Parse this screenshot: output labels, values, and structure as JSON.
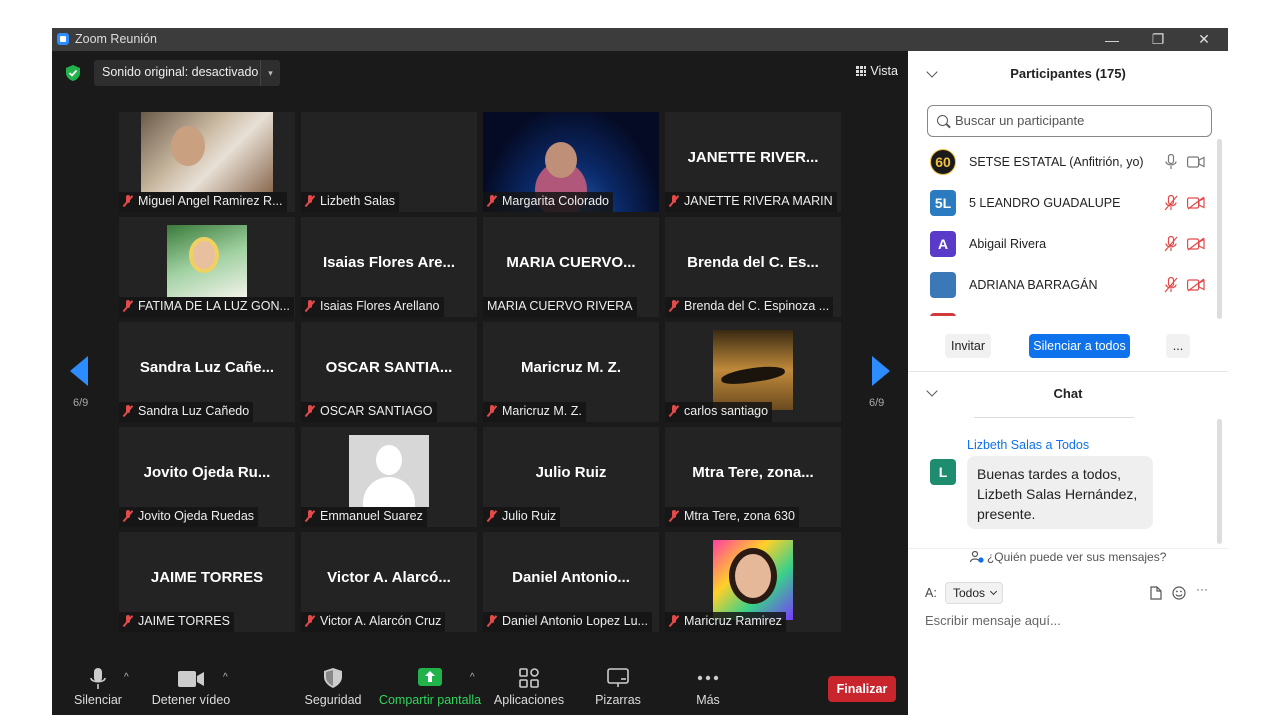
{
  "window": {
    "title": "Zoom Reunión",
    "minimize": "—",
    "restore": "❐",
    "close": "✕"
  },
  "meeting": {
    "sound_label": "Sonido original: desactivado",
    "sound_caret": "▾",
    "view_label": "Vista",
    "page_indicator_left": "6/9",
    "page_indicator_right": "6/9",
    "tiles": [
      {
        "caption": "Miguel Angel Ramirez R...",
        "big": "",
        "photo": "p1"
      },
      {
        "caption": "Lizbeth Salas",
        "big": "",
        "photo": ""
      },
      {
        "caption": "Margarita Colorado",
        "big": "",
        "photo": "p3"
      },
      {
        "caption": "JANETTE RIVERA MARIN",
        "big": "JANETTE RIVER...",
        "photo": ""
      },
      {
        "caption": "FATIMA DE LA LUZ GON...",
        "big": "",
        "photo": "p5"
      },
      {
        "caption": "Isaias Flores Arellano",
        "big": "Isaias Flores Are...",
        "photo": ""
      },
      {
        "caption": "MARIA CUERVO RIVERA",
        "big": "MARIA CUERVO...",
        "photo": "",
        "nomic": true
      },
      {
        "caption": "Brenda del C. Espinoza ...",
        "big": "Brenda del C. Es...",
        "photo": ""
      },
      {
        "caption": "Sandra Luz Cañedo",
        "big": "Sandra Luz Cañe...",
        "photo": ""
      },
      {
        "caption": "OSCAR SANTIAGO",
        "big": "OSCAR SANTIA...",
        "photo": ""
      },
      {
        "caption": "Maricruz M. Z.",
        "big": "Maricruz M. Z.",
        "photo": ""
      },
      {
        "caption": "carlos santiago",
        "big": "",
        "photo": "eagle"
      },
      {
        "caption": "Jovito Ojeda Ruedas",
        "big": "Jovito Ojeda Ru...",
        "photo": ""
      },
      {
        "caption": "Emmanuel Suarez",
        "big": "",
        "photo": "avatar-blank"
      },
      {
        "caption": "Julio Ruiz",
        "big": "Julio Ruiz",
        "photo": ""
      },
      {
        "caption": "Mtra Tere, zona 630",
        "big": "Mtra Tere, zona...",
        "photo": ""
      },
      {
        "caption": "JAIME TORRES",
        "big": "JAIME TORRES",
        "photo": ""
      },
      {
        "caption": "Victor A. Alarcón Cruz",
        "big": "Victor A. Alarcó...",
        "photo": ""
      },
      {
        "caption": "Daniel Antonio Lopez Lu...",
        "big": "Daniel Antonio...",
        "photo": ""
      },
      {
        "caption": "Maricruz Ramirez",
        "big": "",
        "photo": "colorful"
      }
    ]
  },
  "toolbar": {
    "mute": "Silenciar",
    "video": "Detener vídeo",
    "security": "Seguridad",
    "share": "Compartir pantalla",
    "apps": "Aplicaciones",
    "whiteboards": "Pizarras",
    "more": "Más",
    "end": "Finalizar",
    "caret": "^"
  },
  "participants": {
    "title": "Participantes (175)",
    "search_placeholder": "Buscar un participante",
    "list": [
      {
        "name": "SETSE ESTATAL (Anfitrión, yo)",
        "avatar": "60",
        "color": "#1a1a1a",
        "muted": false
      },
      {
        "name": "5 LEANDRO GUADALUPE",
        "avatar": "5L",
        "color": "#2a7bbf",
        "muted": true
      },
      {
        "name": "Abigail Rivera",
        "avatar": "A",
        "color": "#5a3ac8",
        "muted": true
      },
      {
        "name": "ADRIANA BARRAGÁN",
        "avatar": "",
        "color": "#3a78b8",
        "muted": true
      }
    ],
    "invite": "Invitar",
    "mute_all": "Silenciar a todos",
    "more": "..."
  },
  "chat": {
    "title": "Chat",
    "from": "Lizbeth Salas a Todos",
    "avatar": "L",
    "message_line1": "Buenas tardes a todos,",
    "message_line2": "Lizbeth Salas Hernández,",
    "message_line3": "presente.",
    "who_sees": "¿Quién puede ver sus mensajes?",
    "to_label": "A:",
    "to_value": "Todos",
    "input_placeholder": "Escribir mensaje aquí...",
    "more": "···"
  },
  "colors": {
    "accent": "#2d8cff",
    "share_green": "#22b24c",
    "end_red": "#c9252c",
    "muted_red": "#e34a4a",
    "mute_all_blue": "#0e72ed"
  }
}
